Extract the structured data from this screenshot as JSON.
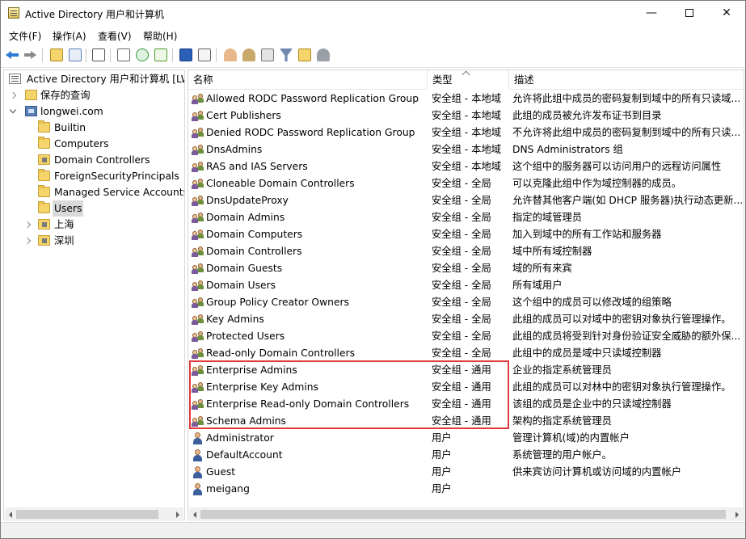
{
  "window": {
    "title": "Active Directory 用户和计算机",
    "minimize": "—",
    "close": "✕"
  },
  "menu": [
    "文件(F)",
    "操作(A)",
    "查看(V)",
    "帮助(H)"
  ],
  "tree": {
    "root": "Active Directory 用户和计算机 [LW-",
    "saved_queries": "保存的查询",
    "domain": "longwei.com",
    "children": [
      "Builtin",
      "Computers",
      "Domain Controllers",
      "ForeignSecurityPrincipals",
      "Managed Service Accounts",
      "Users",
      "上海",
      "深圳"
    ],
    "selected": "Users"
  },
  "columns": {
    "name": "名称",
    "type": "类型",
    "desc": "描述"
  },
  "rows": [
    {
      "name": "Allowed RODC Password Replication Group",
      "type": "安全组 - 本地域",
      "desc": "允许将此组中成员的密码复制到域中的所有只读域...",
      "icon": "group-icon"
    },
    {
      "name": "Cert Publishers",
      "type": "安全组 - 本地域",
      "desc": "此组的成员被允许发布证书到目录",
      "icon": "group-icon"
    },
    {
      "name": "Denied RODC Password Replication Group",
      "type": "安全组 - 本地域",
      "desc": "不允许将此组中成员的密码复制到域中的所有只读...",
      "icon": "group-icon"
    },
    {
      "name": "DnsAdmins",
      "type": "安全组 - 本地域",
      "desc": "DNS Administrators 组",
      "icon": "group-icon"
    },
    {
      "name": "RAS and IAS Servers",
      "type": "安全组 - 本地域",
      "desc": "这个组中的服务器可以访问用户的远程访问属性",
      "icon": "group-icon"
    },
    {
      "name": "Cloneable Domain Controllers",
      "type": "安全组 - 全局",
      "desc": "可以克隆此组中作为域控制器的成员。",
      "icon": "group-icon"
    },
    {
      "name": "DnsUpdateProxy",
      "type": "安全组 - 全局",
      "desc": "允许替其他客户端(如 DHCP 服务器)执行动态更新...",
      "icon": "group-icon"
    },
    {
      "name": "Domain Admins",
      "type": "安全组 - 全局",
      "desc": "指定的域管理员",
      "icon": "group-icon"
    },
    {
      "name": "Domain Computers",
      "type": "安全组 - 全局",
      "desc": "加入到域中的所有工作站和服务器",
      "icon": "group-icon"
    },
    {
      "name": "Domain Controllers",
      "type": "安全组 - 全局",
      "desc": "域中所有域控制器",
      "icon": "group-icon"
    },
    {
      "name": "Domain Guests",
      "type": "安全组 - 全局",
      "desc": "域的所有来宾",
      "icon": "group-icon"
    },
    {
      "name": "Domain Users",
      "type": "安全组 - 全局",
      "desc": "所有域用户",
      "icon": "group-icon"
    },
    {
      "name": "Group Policy Creator Owners",
      "type": "安全组 - 全局",
      "desc": "这个组中的成员可以修改域的组策略",
      "icon": "group-icon"
    },
    {
      "name": "Key Admins",
      "type": "安全组 - 全局",
      "desc": "此组的成员可以对域中的密钥对象执行管理操作。",
      "icon": "group-icon"
    },
    {
      "name": "Protected Users",
      "type": "安全组 - 全局",
      "desc": "此组的成员将受到针对身份验证安全威胁的额外保...",
      "icon": "group-icon"
    },
    {
      "name": "Read-only Domain Controllers",
      "type": "安全组 - 全局",
      "desc": "此组中的成员是域中只读域控制器",
      "icon": "group-icon"
    },
    {
      "name": "Enterprise Admins",
      "type": "安全组 - 通用",
      "desc": "企业的指定系统管理员",
      "icon": "group-icon"
    },
    {
      "name": "Enterprise Key Admins",
      "type": "安全组 - 通用",
      "desc": "此组的成员可以对林中的密钥对象执行管理操作。",
      "icon": "group-icon"
    },
    {
      "name": "Enterprise Read-only Domain Controllers",
      "type": "安全组 - 通用",
      "desc": "该组的成员是企业中的只读域控制器",
      "icon": "group-icon"
    },
    {
      "name": "Schema Admins",
      "type": "安全组 - 通用",
      "desc": "架构的指定系统管理员",
      "icon": "group-icon"
    },
    {
      "name": "Administrator",
      "type": "用户",
      "desc": "管理计算机(域)的内置帐户",
      "icon": "user-icon"
    },
    {
      "name": "DefaultAccount",
      "type": "用户",
      "desc": "系统管理的用户帐户。",
      "icon": "user-icon"
    },
    {
      "name": "Guest",
      "type": "用户",
      "desc": "供来宾访问计算机或访问域的内置帐户",
      "icon": "user-icon"
    },
    {
      "name": "meigang",
      "type": "用户",
      "desc": "",
      "icon": "user-icon"
    }
  ],
  "colors": {
    "highlight_border": "#e0383b",
    "selection": "#d9d9d9",
    "accent_blue": "#2a7bd3"
  }
}
